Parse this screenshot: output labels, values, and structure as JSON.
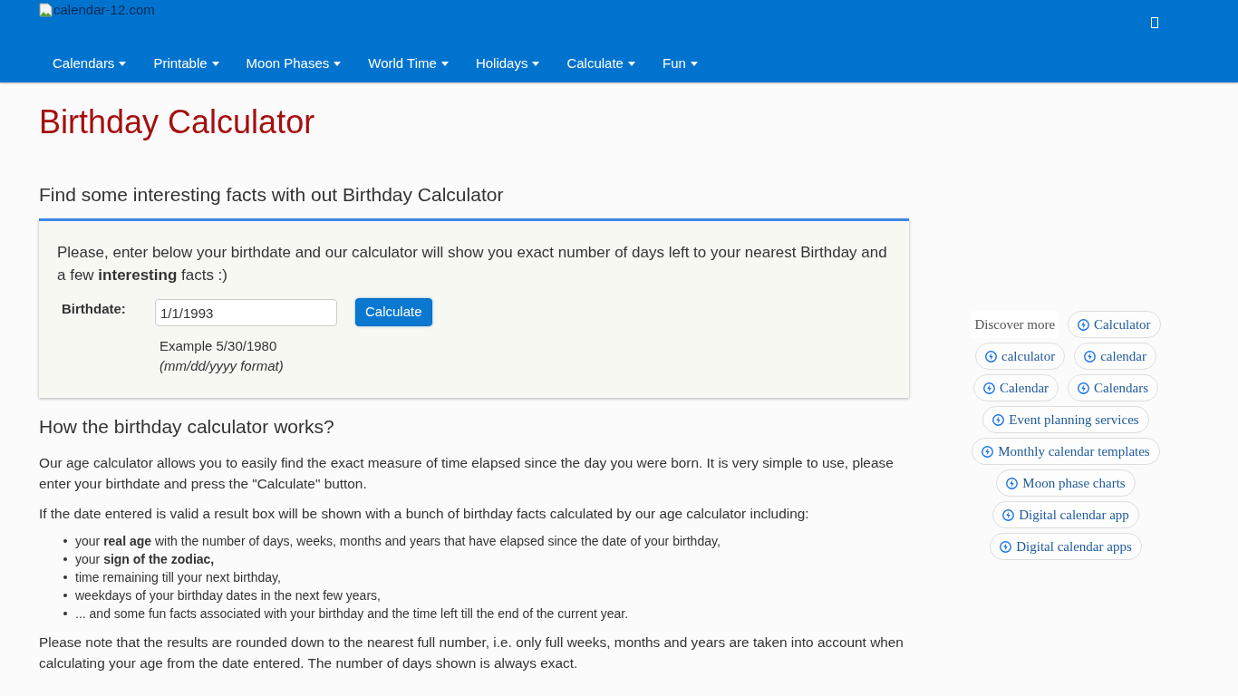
{
  "header": {
    "logo_alt": "calendar-12.com",
    "nav": [
      {
        "label": "Calendars"
      },
      {
        "label": "Printable"
      },
      {
        "label": "Moon Phases"
      },
      {
        "label": "World Time"
      },
      {
        "label": "Holidays"
      },
      {
        "label": "Calculate"
      },
      {
        "label": "Fun"
      }
    ]
  },
  "title": "Birthday Calculator",
  "subtitle": "Find some interesting facts with out Birthday Calculator",
  "calculator": {
    "intro": "Please, enter below your birthdate and our calculator will show you exact number of days left to your nearest Birthday and a few **interesting** facts :)",
    "field_label": "Birthdate:",
    "field_value": "1/1/1993",
    "button": "Calculate",
    "example": "Example 5/30/1980",
    "format_hint": "(mm/dd/yyyy format)"
  },
  "how_it_works": {
    "heading": "How the birthday calculator works?",
    "paragraphs": [
      "Our age calculator allows you to easily find the exact measure of time elapsed since the day you were born. It is very simple to use, please enter your birthdate and press the \"Calculate\" button.",
      "If the date entered is valid a result box will be shown with a bunch of birthday facts calculated by our age calculator including:"
    ],
    "list": [
      "your **real age** with the number of days, weeks, months and years that have elapsed since the date of your birthday,",
      "your **sign of the zodiac,**",
      "time remaining till your next birthday,",
      "weekdays of your birthday dates in the next few years,",
      "... and some fun facts associated with your birthday and the time left till the end of the current year."
    ],
    "note": "Please note that the results are rounded down to the nearest full number, i.e. only full weeks, months and years are taken into account when calculating your age from the date entered. The number of days shown is always exact."
  },
  "sidebar": {
    "label": "Discover more",
    "chips": [
      "Calculator",
      "calculator",
      "calendar",
      "Calendar",
      "Calendars",
      "Event planning services",
      "Monthly calendar templates",
      "Moon phase charts",
      "Digital calendar app",
      "Digital calendar apps"
    ]
  }
}
